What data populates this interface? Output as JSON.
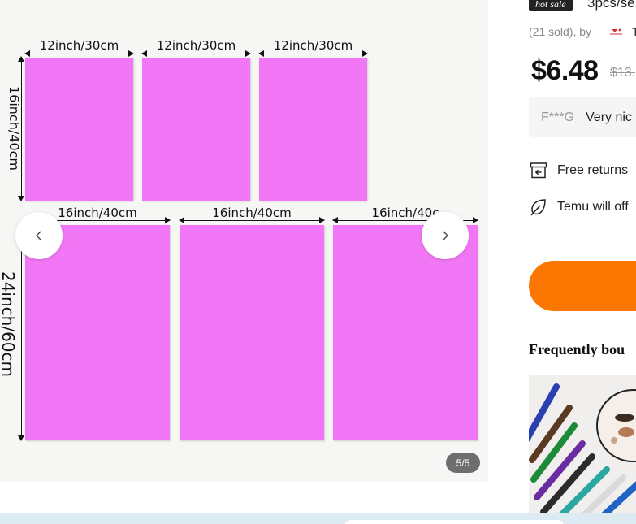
{
  "gallery": {
    "counter": "5/5",
    "dimensions": {
      "top_width": "12inch/30cm",
      "top_height": "16inch/40cm",
      "bottom_width": "16inch/40cm",
      "bottom_height": "24inch/60cm",
      "bottom_width_partial": "16inch/40c"
    },
    "panel_color": "#f277f6"
  },
  "product": {
    "badge": "hot sale",
    "title_fragment": "3pcs/se",
    "sold": "(21 sold), by",
    "store_fragment": "T",
    "price": "$6.48",
    "old_price": "$13.",
    "review": {
      "user": "F***G",
      "text": "Very nic"
    },
    "features": [
      {
        "icon": "return-box-icon",
        "label": "Free returns"
      },
      {
        "icon": "leaf-icon",
        "label": "Temu will off"
      }
    ],
    "accent_color": "#fb7701",
    "frequently_bought": "Frequently bou"
  }
}
